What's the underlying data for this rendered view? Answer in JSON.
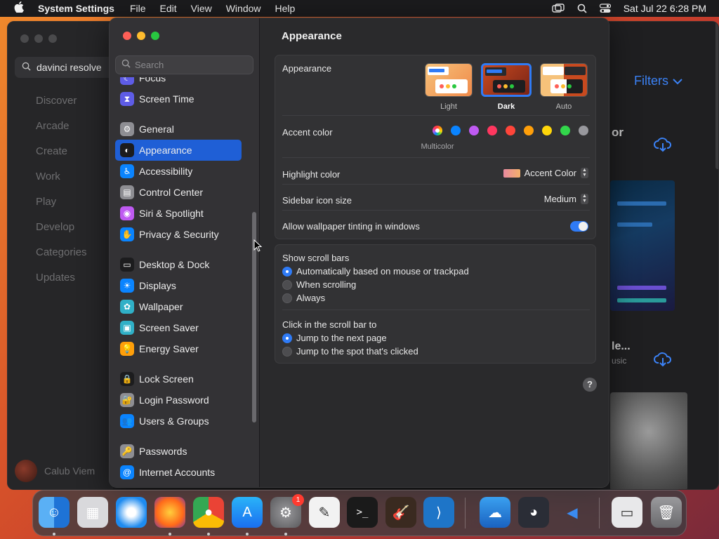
{
  "menubar": {
    "app_name": "System Settings",
    "menus": [
      "File",
      "Edit",
      "View",
      "Window",
      "Help"
    ],
    "datetime": "Sat Jul 22  6:28 PM"
  },
  "appstore": {
    "search_value": "davinci resolve",
    "nav": [
      "Discover",
      "Arcade",
      "Create",
      "Work",
      "Play",
      "Develop",
      "Categories",
      "Updates"
    ],
    "user_name": "Calub Viem",
    "filters_label": "Filters",
    "result1_fragment": "or",
    "result2_title_fragment": "le...",
    "result2_sub_fragment": "usic"
  },
  "settings": {
    "search_placeholder": "Search",
    "sidebar": [
      {
        "label": "Focus",
        "icon": "moon-icon",
        "color": "#5e5ce6"
      },
      {
        "label": "Screen Time",
        "icon": "hourglass-icon",
        "color": "#5e5ce6"
      },
      {
        "label": "General",
        "icon": "gear-icon",
        "color": "#8e8e93"
      },
      {
        "label": "Appearance",
        "icon": "appearance-icon",
        "color": "#1c1c1e",
        "selected": true
      },
      {
        "label": "Accessibility",
        "icon": "accessibility-icon",
        "color": "#0a84ff"
      },
      {
        "label": "Control Center",
        "icon": "control-center-icon",
        "color": "#8e8e93"
      },
      {
        "label": "Siri & Spotlight",
        "icon": "siri-icon",
        "color": "#bf5af2"
      },
      {
        "label": "Privacy & Security",
        "icon": "hand-icon",
        "color": "#0a84ff"
      },
      {
        "label": "Desktop & Dock",
        "icon": "dock-icon",
        "color": "#1c1c1e"
      },
      {
        "label": "Displays",
        "icon": "sun-icon",
        "color": "#0a84ff"
      },
      {
        "label": "Wallpaper",
        "icon": "flower-icon",
        "color": "#30b0c7"
      },
      {
        "label": "Screen Saver",
        "icon": "screen-saver-icon",
        "color": "#30b0c7"
      },
      {
        "label": "Energy Saver",
        "icon": "bulb-icon",
        "color": "#ff9f0a"
      },
      {
        "label": "Lock Screen",
        "icon": "lock-icon",
        "color": "#1c1c1e"
      },
      {
        "label": "Login Password",
        "icon": "padlock-icon",
        "color": "#8e8e93"
      },
      {
        "label": "Users & Groups",
        "icon": "users-icon",
        "color": "#0a84ff"
      },
      {
        "label": "Passwords",
        "icon": "key-icon",
        "color": "#8e8e93"
      },
      {
        "label": "Internet Accounts",
        "icon": "at-icon",
        "color": "#0a84ff"
      }
    ],
    "pane_title": "Appearance",
    "appearance": {
      "label": "Appearance",
      "options": [
        "Light",
        "Dark",
        "Auto"
      ],
      "selected": "Dark"
    },
    "accent": {
      "label": "Accent color",
      "selected_name": "Multicolor",
      "colors": [
        "#0a84ff",
        "#bf5af2",
        "#ff375f",
        "#ff453a",
        "#ff9f0a",
        "#ffd60a",
        "#32d74b",
        "#98989d"
      ]
    },
    "highlight": {
      "label": "Highlight color",
      "value": "Accent Color"
    },
    "sidebar_icon_size": {
      "label": "Sidebar icon size",
      "value": "Medium"
    },
    "wallpaper_tinting": {
      "label": "Allow wallpaper tinting in windows",
      "on": true
    },
    "scroll_bars": {
      "label": "Show scroll bars",
      "options": [
        "Automatically based on mouse or trackpad",
        "When scrolling",
        "Always"
      ],
      "selected": 0
    },
    "click_scroll": {
      "label": "Click in the scroll bar to",
      "options": [
        "Jump to the next page",
        "Jump to the spot that's clicked"
      ],
      "selected": 0
    },
    "help": "?"
  },
  "dock": {
    "items": [
      "finder-icon",
      "launchpad-icon",
      "safari-icon",
      "firefox-icon",
      "chrome-icon",
      "app-store-icon",
      "system-settings-icon",
      "textedit-icon",
      "terminal-icon",
      "garageband-icon",
      "vscode-icon",
      "weather-icon",
      "davinci-resolve-icon",
      "instruments-icon",
      "chrome-window-icon",
      "trash-icon"
    ],
    "settings_badge": "1"
  }
}
